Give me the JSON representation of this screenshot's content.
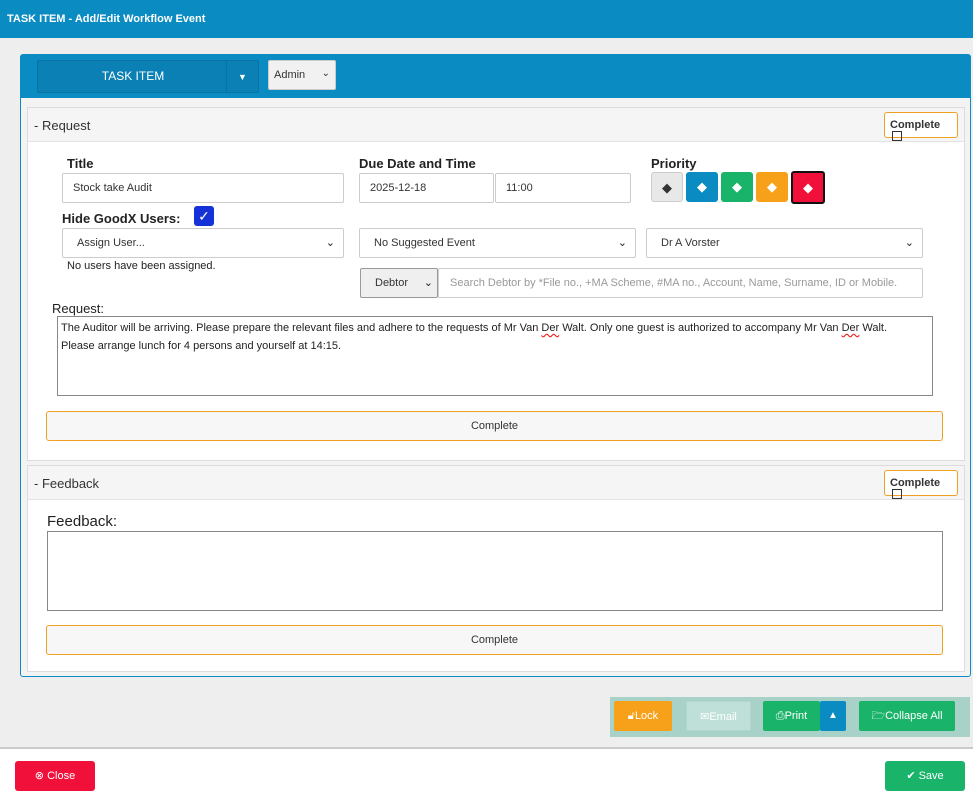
{
  "window": {
    "title": "TASK ITEM - Add/Edit Workflow Event"
  },
  "header": {
    "task_dropdown": "TASK ITEM",
    "admin_select": "Admin"
  },
  "request": {
    "section_title": "Request",
    "complete_check": "Complete",
    "title_label": "Title",
    "title_value": "Stock take Audit",
    "due_label": "Due Date and Time",
    "due_date": "2025-12-18",
    "due_time": "11:00",
    "priority_label": "Priority",
    "hide_users_label": "Hide GoodX Users:",
    "assign_user": "Assign User...",
    "no_users_text": "No users have been assigned.",
    "suggested_event": "No Suggested Event",
    "doctor": "Dr A Vorster",
    "debtor_select": "Debtor",
    "debtor_search_placeholder": "Search Debtor by *File no., +MA Scheme, #MA no., Account, Name, Surname, ID or Mobile.",
    "request_label": "Request:",
    "request_text_1a": "The Auditor will be arriving. Please prepare the relevant files and adhere to the requests of Mr Van ",
    "request_text_1b": "Der",
    "request_text_1c": " Walt. Only one guest is authorized to accompany Mr Van ",
    "request_text_1d": "Der",
    "request_text_1e": " Walt.",
    "request_text_2": "Please arrange lunch for 4 persons and yourself at 14:15.",
    "complete_button": "Complete"
  },
  "feedback": {
    "section_title": "Feedback",
    "complete_check": "Complete",
    "feedback_label": "Feedback:",
    "complete_button": "Complete"
  },
  "toolbar": {
    "lock": "Lock",
    "email": "Email",
    "print": "Print",
    "collapse_all": "Collapse All"
  },
  "footer": {
    "close": "Close",
    "save": "Save"
  },
  "colors": {
    "brand_blue": "#0a8bc2",
    "priority": [
      "#e8e8e8",
      "#0a8bc2",
      "#1ab36a",
      "#f7a11a",
      "#f0103a"
    ],
    "lock": "#f7a11a",
    "email": "#a8d2c8",
    "print": "#1ab36a",
    "close": "#f0103a",
    "save": "#1ab36a"
  }
}
